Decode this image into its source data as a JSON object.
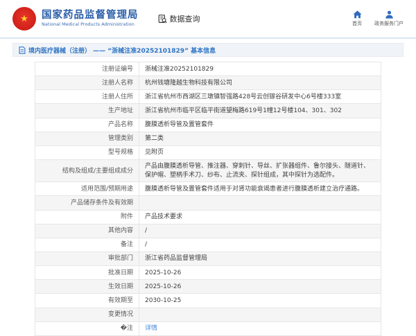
{
  "header": {
    "logo_title": "国家药品监督管理局",
    "logo_subtitle": "National Medical Products Administration",
    "nav_query_label": "数据查询",
    "nav_home_label": "首页",
    "nav_portal_label": "政务服务门户"
  },
  "title_bar": {
    "text": "境内医疗器械（注册） —— “浙械注准20252101829” 基本信息"
  },
  "table": {
    "rows": [
      {
        "label": "注册证编号",
        "value": "浙械注准20252101829"
      },
      {
        "label": "注册人名称",
        "value": "杭州钱塘隆越生物科技有限公司"
      },
      {
        "label": "注册人住所",
        "value": "浙江省杭州市西湖区三墩镇智强路428号云创镓谷研发中心6号楼333室"
      },
      {
        "label": "生产地址",
        "value": "浙江省杭州市临平区临平街道望梅路619号1幢12号楼104、301、302"
      },
      {
        "label": "产品名称",
        "value": "腹膜透析导管及置管套件"
      },
      {
        "label": "管理类别",
        "value": "第二类"
      },
      {
        "label": "型号规格",
        "value": "见附页"
      },
      {
        "label": "结构及组成/主要组成成分",
        "value": "产品由腹膜透析导管、推注器、穿刺针、导丝、扩张器组件、鲁尔接头、隧道针、保护帽、塑柄手术刀、纱布、止流夹、探针组成，其中探针为选配件。"
      },
      {
        "label": "适用范围/预期用途",
        "value": "腹膜透析导管及置管套件适用于对肾功能衰竭患者进行腹膜透析建立治疗通路。"
      },
      {
        "label": "产品储存条件及有效期",
        "value": ""
      },
      {
        "label": "附件",
        "value": "产品技术要求"
      },
      {
        "label": "其他内容",
        "value": "/"
      },
      {
        "label": "备注",
        "value": "/"
      },
      {
        "label": "审批部门",
        "value": "浙江省药品监督管理局"
      },
      {
        "label": "批准日期",
        "value": "2025-10-26"
      },
      {
        "label": "生效日期",
        "value": "2025-10-26"
      },
      {
        "label": "有效期至",
        "value": "2030-10-25"
      },
      {
        "label": "变更情况",
        "value": ""
      },
      {
        "label": "�注",
        "value": "详情",
        "link": true
      }
    ]
  },
  "colors": {
    "brand_blue": "#2a5ea8",
    "icon_blue": "#2f6bbf",
    "emblem_red": "#d0201a",
    "emblem_yellow": "#ffd427",
    "title_bar_text": "#2e74c4",
    "title_bar_bg": "#f0f3f7",
    "link_blue": "#3f87d8",
    "row_alt_bg": "#f5f5f5",
    "table_border": "#dedede"
  }
}
